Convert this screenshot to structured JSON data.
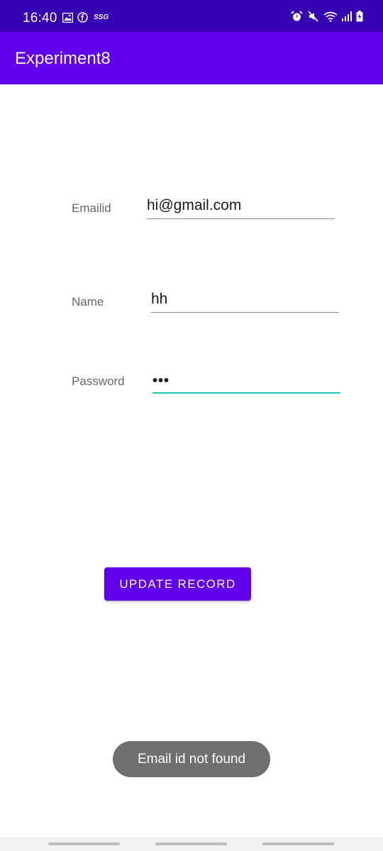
{
  "status_bar": {
    "time": "16:40",
    "network_label": "SSG",
    "left_icons": [
      "image-icon",
      "facebook-icon"
    ],
    "right_icons": [
      "alarm-icon",
      "mute-icon",
      "wifi-icon",
      "signal-icon",
      "battery-icon"
    ]
  },
  "app_bar": {
    "title": "Experiment8"
  },
  "form": {
    "email": {
      "label": "Emailid",
      "value": "hi@gmail.com"
    },
    "name": {
      "label": "Name",
      "value": "hh"
    },
    "password": {
      "label": "Password",
      "value": "•••"
    }
  },
  "update_button": {
    "label": "UPDATE RECORD"
  },
  "toast": {
    "message": "Email id not found"
  },
  "colors": {
    "status_bar": "#3700B3",
    "primary": "#6200EE",
    "accent": "#20C5B6",
    "toast": "#6f6f6f"
  }
}
